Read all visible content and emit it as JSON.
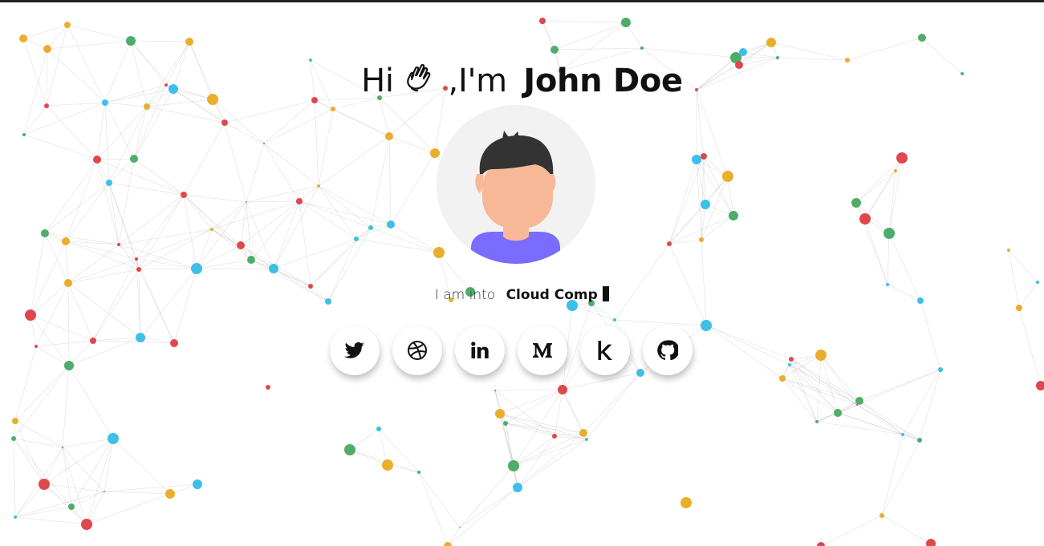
{
  "page": {
    "accent_color": "#111111"
  },
  "background": {
    "node_colors": {
      "red": "#e0474c",
      "yellow": "#e9ae2b",
      "green": "#4dad69",
      "blue": "#3dbfe8"
    },
    "line_color": "#9a9a9a"
  },
  "hero": {
    "greeting": "Hi",
    "greeting_icon": "waving-hand-icon",
    "intro": ",I'm",
    "name": "John Doe",
    "avatar_icon": "avatar-icon",
    "tagline_prefix": "I am into",
    "tagline_typed": "Cloud Comp",
    "cursor_icon": "cursor-block-icon"
  },
  "social": [
    {
      "name": "twitter",
      "icon": "twitter-icon"
    },
    {
      "name": "dribbble",
      "icon": "dribbble-icon"
    },
    {
      "name": "linkedin",
      "icon": "linkedin-icon"
    },
    {
      "name": "medium",
      "icon": "medium-icon"
    },
    {
      "name": "kaggle",
      "icon": "kaggle-icon"
    },
    {
      "name": "github",
      "icon": "github-icon"
    }
  ]
}
